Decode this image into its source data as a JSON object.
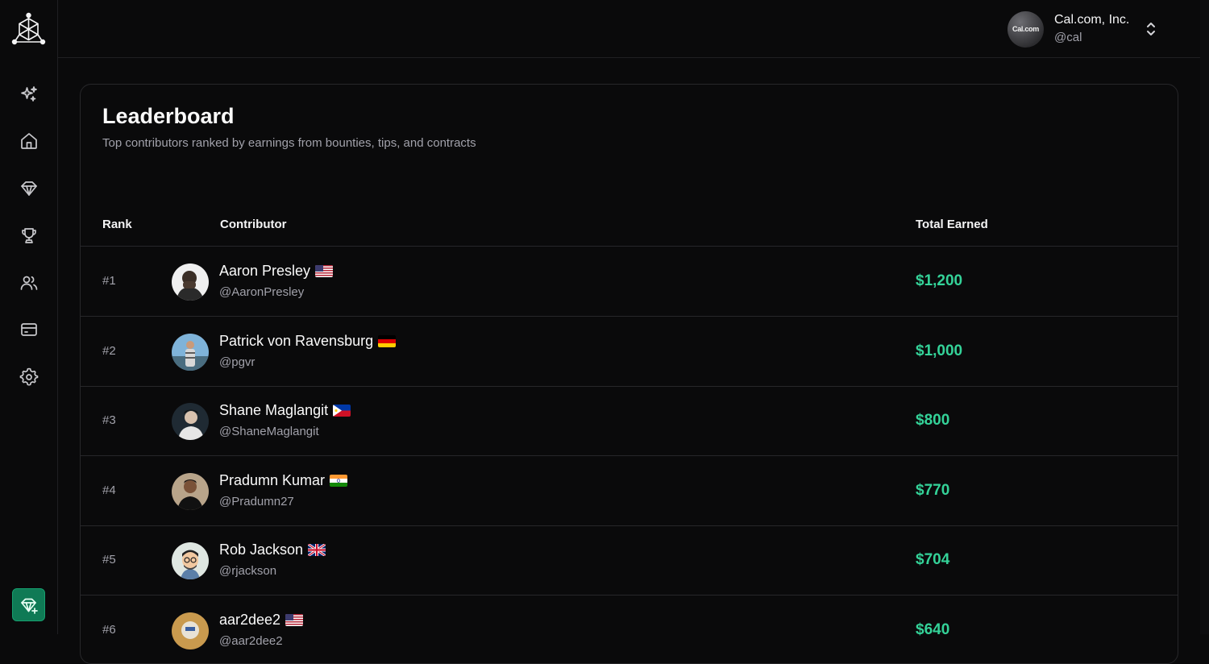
{
  "sidebar": {
    "logo": "algora-logo",
    "items": [
      {
        "icon": "sparkles-icon",
        "label": ""
      },
      {
        "icon": "home-icon",
        "label": ""
      },
      {
        "icon": "diamond-tag-icon",
        "label": ""
      },
      {
        "icon": "trophy-icon",
        "label": ""
      },
      {
        "icon": "users-icon",
        "label": ""
      },
      {
        "icon": "credit-card-icon",
        "label": ""
      },
      {
        "icon": "gear-icon",
        "label": ""
      }
    ],
    "new_bounty_icon": "diamond-plus-icon"
  },
  "org": {
    "avatar_text": "Cal.com",
    "name": "Cal.com, Inc.",
    "handle": "@cal"
  },
  "leaderboard": {
    "title": "Leaderboard",
    "subtitle": "Top contributors ranked by earnings from bounties, tips, and contracts",
    "columns": {
      "rank": "Rank",
      "contributor": "Contributor",
      "total": "Total Earned"
    },
    "rows": [
      {
        "rank": "#1",
        "name": "Aaron Presley",
        "flag": "us",
        "handle": "@AaronPresley",
        "earned": "$1,200"
      },
      {
        "rank": "#2",
        "name": "Patrick von Ravensburg",
        "flag": "de",
        "handle": "@pgvr",
        "earned": "$1,000"
      },
      {
        "rank": "#3",
        "name": "Shane Maglangit",
        "flag": "ph",
        "handle": "@ShaneMaglangit",
        "earned": "$800"
      },
      {
        "rank": "#4",
        "name": "Pradumn Kumar",
        "flag": "in",
        "handle": "@Pradumn27",
        "earned": "$770"
      },
      {
        "rank": "#5",
        "name": "Rob Jackson",
        "flag": "gb",
        "handle": "@rjackson",
        "earned": "$704"
      },
      {
        "rank": "#6",
        "name": "aar2dee2",
        "flag": "us",
        "handle": "@aar2dee2",
        "earned": "$640"
      }
    ]
  },
  "colors": {
    "accent": "#34d399",
    "button": "#0f7a55",
    "background": "#0a0a0b",
    "border": "#27272a"
  }
}
